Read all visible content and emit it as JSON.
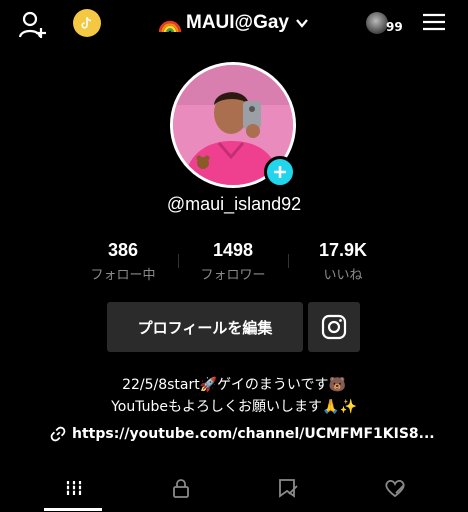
{
  "header": {
    "title": "MAUI@Gay",
    "visitor_count": "99",
    "icons": {
      "add_friend": "add-person-icon",
      "coin": "tiktok-coin-icon",
      "rainbow": "rainbow-emoji",
      "chevron": "chevron-down-icon",
      "menu": "hamburger-menu-icon"
    }
  },
  "profile": {
    "username": "@maui_island92",
    "accent_color": "#20d5ec"
  },
  "stats": [
    {
      "value": "386",
      "label": "フォロー中"
    },
    {
      "value": "1498",
      "label": "フォロワー"
    },
    {
      "value": "17.9K",
      "label": "いいね"
    }
  ],
  "actions": {
    "edit_profile_label": "プロフィールを編集",
    "instagram_icon": "instagram-icon"
  },
  "bio": {
    "line1": "22/5/8start🚀ゲイのまういです🐻",
    "line2": "YouTubeもよろしくお願いします🙏✨",
    "link": "https://youtube.com/channel/UCMFMF1KIS8..."
  },
  "tabs": [
    {
      "name": "videos",
      "icon": "grid-icon",
      "active": true
    },
    {
      "name": "private",
      "icon": "lock-icon",
      "active": false
    },
    {
      "name": "favorites",
      "icon": "bookmark-icon",
      "active": false
    },
    {
      "name": "liked",
      "icon": "heart-icon",
      "active": false
    }
  ]
}
